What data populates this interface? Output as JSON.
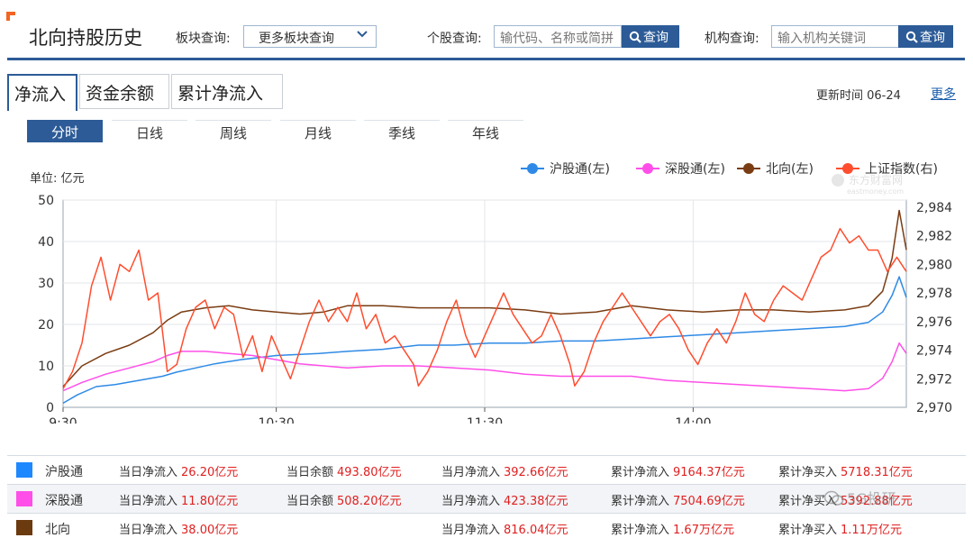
{
  "header": {
    "title": "北向持股历史",
    "sector_label": "板块查询:",
    "sector_select": "更多板块查询",
    "stock_label": "个股查询:",
    "stock_placeholder": "输代码、名称或简拼",
    "org_label": "机构查询:",
    "org_placeholder": "输入机构关键词",
    "search_button": "查询"
  },
  "tabs": [
    "净流入",
    "资金余额",
    "累计净流入"
  ],
  "update_time": "更新时间 06-24",
  "more_link": "更多",
  "period_tabs": [
    "分时",
    "日线",
    "周线",
    "月线",
    "季线",
    "年线"
  ],
  "unit_label": "单位: 亿元",
  "watermark_chart": "东方财富网",
  "watermark_chart_sub": "eastmoney.com",
  "watermark_corner": "5G投研",
  "chart_data": {
    "type": "line",
    "x_ticks": [
      "9:30",
      "10:30",
      "11:30",
      "14:00"
    ],
    "y_left": {
      "ticks": [
        0,
        10,
        20,
        30,
        40,
        50
      ],
      "range": [
        0,
        50
      ]
    },
    "y_right": {
      "ticks": [
        2970,
        2972,
        2974,
        2976,
        2978,
        2980,
        2982,
        2984
      ],
      "range": [
        2970,
        2984.5
      ]
    },
    "grid": true,
    "legend_position": "top-right",
    "series": [
      {
        "name": "沪股通(左)",
        "color": "#2e8ae6",
        "axis": "left",
        "points": [
          [
            0,
            1
          ],
          [
            6,
            3
          ],
          [
            14,
            5
          ],
          [
            22,
            5.5
          ],
          [
            32,
            6.5
          ],
          [
            42,
            7.5
          ],
          [
            48,
            8.5
          ],
          [
            56,
            9.5
          ],
          [
            64,
            10.5
          ],
          [
            75,
            11.5
          ],
          [
            90,
            12.5
          ],
          [
            108,
            13
          ],
          [
            120,
            13.5
          ],
          [
            135,
            14
          ],
          [
            150,
            15
          ],
          [
            165,
            15
          ],
          [
            180,
            15.5
          ],
          [
            195,
            15.5
          ],
          [
            210,
            16
          ],
          [
            225,
            16
          ],
          [
            240,
            16.5
          ],
          [
            255,
            17
          ],
          [
            270,
            17.5
          ],
          [
            285,
            18
          ],
          [
            300,
            18.5
          ],
          [
            315,
            19
          ],
          [
            330,
            19.5
          ],
          [
            340,
            20.5
          ],
          [
            346,
            23
          ],
          [
            350,
            27
          ],
          [
            353,
            31.5
          ],
          [
            356,
            26.5
          ]
        ]
      },
      {
        "name": "深股通(左)",
        "color": "#ff4fe8",
        "axis": "left",
        "points": [
          [
            0,
            4
          ],
          [
            8,
            6
          ],
          [
            18,
            8
          ],
          [
            28,
            9.5
          ],
          [
            38,
            11
          ],
          [
            44,
            12.5
          ],
          [
            50,
            13.5
          ],
          [
            60,
            13.5
          ],
          [
            70,
            13
          ],
          [
            80,
            12.5
          ],
          [
            90,
            11.5
          ],
          [
            100,
            10.5
          ],
          [
            110,
            10
          ],
          [
            120,
            9.5
          ],
          [
            135,
            10
          ],
          [
            150,
            10
          ],
          [
            165,
            9.5
          ],
          [
            180,
            9
          ],
          [
            195,
            8
          ],
          [
            210,
            7.5
          ],
          [
            225,
            7.5
          ],
          [
            240,
            7.5
          ],
          [
            255,
            6.5
          ],
          [
            270,
            6
          ],
          [
            285,
            5.5
          ],
          [
            300,
            5
          ],
          [
            315,
            4.5
          ],
          [
            330,
            4
          ],
          [
            340,
            4.5
          ],
          [
            346,
            7
          ],
          [
            350,
            11
          ],
          [
            353,
            15.5
          ],
          [
            356,
            13
          ]
        ]
      },
      {
        "name": "北向(左)",
        "color": "#7a3c12",
        "axis": "left",
        "points": [
          [
            0,
            5
          ],
          [
            8,
            10
          ],
          [
            18,
            13
          ],
          [
            28,
            15
          ],
          [
            38,
            18
          ],
          [
            44,
            21
          ],
          [
            50,
            23
          ],
          [
            60,
            24
          ],
          [
            70,
            24.5
          ],
          [
            80,
            23.5
          ],
          [
            90,
            23
          ],
          [
            100,
            22.5
          ],
          [
            110,
            23
          ],
          [
            120,
            24.5
          ],
          [
            135,
            24.5
          ],
          [
            150,
            24
          ],
          [
            165,
            24
          ],
          [
            180,
            24
          ],
          [
            195,
            23.5
          ],
          [
            210,
            22.5
          ],
          [
            225,
            23
          ],
          [
            240,
            24.5
          ],
          [
            255,
            23.5
          ],
          [
            270,
            23
          ],
          [
            285,
            23.5
          ],
          [
            300,
            23.5
          ],
          [
            315,
            23
          ],
          [
            330,
            23.5
          ],
          [
            340,
            24.5
          ],
          [
            346,
            28
          ],
          [
            350,
            36
          ],
          [
            353,
            47.5
          ],
          [
            356,
            38
          ]
        ]
      },
      {
        "name": "上证指数(右)",
        "color": "#ff4d2e",
        "axis": "right",
        "points": [
          [
            0,
            2971.3
          ],
          [
            4,
            2972.5
          ],
          [
            8,
            2974.5
          ],
          [
            12,
            2978.5
          ],
          [
            16,
            2980.5
          ],
          [
            20,
            2977.5
          ],
          [
            24,
            2980
          ],
          [
            28,
            2979.5
          ],
          [
            32,
            2981
          ],
          [
            36,
            2977.5
          ],
          [
            40,
            2978
          ],
          [
            44,
            2972.5
          ],
          [
            48,
            2973
          ],
          [
            52,
            2975.5
          ],
          [
            56,
            2977
          ],
          [
            60,
            2977.5
          ],
          [
            64,
            2975.5
          ],
          [
            68,
            2977
          ],
          [
            72,
            2976.5
          ],
          [
            76,
            2973.5
          ],
          [
            80,
            2975
          ],
          [
            84,
            2972.5
          ],
          [
            88,
            2975
          ],
          [
            92,
            2973.5
          ],
          [
            96,
            2972
          ],
          [
            100,
            2974
          ],
          [
            104,
            2976
          ],
          [
            108,
            2977.5
          ],
          [
            112,
            2976
          ],
          [
            116,
            2977
          ],
          [
            120,
            2976
          ],
          [
            124,
            2978
          ],
          [
            128,
            2975.5
          ],
          [
            132,
            2976.5
          ],
          [
            136,
            2974.5
          ],
          [
            140,
            2975
          ],
          [
            144,
            2974
          ],
          [
            148,
            2973
          ],
          [
            150,
            2971.5
          ],
          [
            154,
            2972.5
          ],
          [
            158,
            2974
          ],
          [
            162,
            2976
          ],
          [
            166,
            2977.5
          ],
          [
            170,
            2975
          ],
          [
            174,
            2973.5
          ],
          [
            178,
            2975
          ],
          [
            182,
            2976.5
          ],
          [
            186,
            2978
          ],
          [
            190,
            2976.5
          ],
          [
            194,
            2975.5
          ],
          [
            198,
            2974.5
          ],
          [
            202,
            2975
          ],
          [
            206,
            2976.5
          ],
          [
            210,
            2975
          ],
          [
            214,
            2973
          ],
          [
            216,
            2971.5
          ],
          [
            220,
            2972.5
          ],
          [
            224,
            2974.5
          ],
          [
            228,
            2976
          ],
          [
            232,
            2977
          ],
          [
            236,
            2978
          ],
          [
            240,
            2977
          ],
          [
            244,
            2976
          ],
          [
            248,
            2975
          ],
          [
            252,
            2976
          ],
          [
            256,
            2976.5
          ],
          [
            260,
            2975.5
          ],
          [
            264,
            2974
          ],
          [
            268,
            2973
          ],
          [
            272,
            2974.5
          ],
          [
            276,
            2975.5
          ],
          [
            280,
            2974.5
          ],
          [
            284,
            2976
          ],
          [
            288,
            2978
          ],
          [
            292,
            2976.5
          ],
          [
            296,
            2976
          ],
          [
            300,
            2977.5
          ],
          [
            304,
            2978.5
          ],
          [
            308,
            2978
          ],
          [
            312,
            2977.5
          ],
          [
            316,
            2979
          ],
          [
            320,
            2980.5
          ],
          [
            324,
            2981
          ],
          [
            328,
            2982.5
          ],
          [
            332,
            2981.5
          ],
          [
            336,
            2982
          ],
          [
            340,
            2981
          ],
          [
            344,
            2981
          ],
          [
            348,
            2979.5
          ],
          [
            352,
            2980.5
          ],
          [
            356,
            2979.5
          ]
        ]
      }
    ]
  },
  "summary": {
    "rows": [
      {
        "name": "沪股通",
        "color": "#1e88ff",
        "cells": [
          {
            "label": "当日净流入",
            "value": "26.20亿元"
          },
          {
            "label": "当日余额",
            "value": "493.80亿元"
          },
          {
            "label": "当月净流入",
            "value": "392.66亿元"
          },
          {
            "label": "累计净流入",
            "value": "9164.37亿元"
          },
          {
            "label": "累计净买入",
            "value": "5718.31亿元"
          }
        ]
      },
      {
        "name": "深股通",
        "color": "#ff4fe8",
        "cells": [
          {
            "label": "当日净流入",
            "value": "11.80亿元"
          },
          {
            "label": "当日余额",
            "value": "508.20亿元"
          },
          {
            "label": "当月净流入",
            "value": "423.38亿元"
          },
          {
            "label": "累计净流入",
            "value": "7504.69亿元"
          },
          {
            "label": "累计净买入",
            "value": "5392.88亿元"
          }
        ]
      },
      {
        "name": "北向",
        "color": "#6b3a0f",
        "cells": [
          {
            "label": "当日净流入",
            "value": "38.00亿元"
          },
          {
            "label": "",
            "value": ""
          },
          {
            "label": "当月净流入",
            "value": "816.04亿元"
          },
          {
            "label": "累计净流入",
            "value": "1.67万亿元"
          },
          {
            "label": "累计净买入",
            "value": "1.11万亿元"
          }
        ]
      }
    ]
  }
}
